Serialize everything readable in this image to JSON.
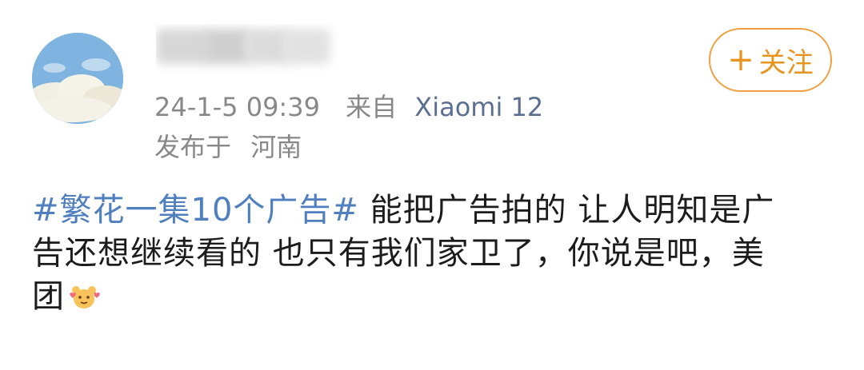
{
  "post": {
    "time": "24-1-5 09:39",
    "source_label": "来自",
    "device": "Xiaomi 12",
    "location_label": "发布于",
    "location": "河南",
    "follow_button": "关注",
    "follow_icon": "plus-icon",
    "hashtag": "#繁花一集10个广告#",
    "text_line1": "能把广告拍的 让人明知是广",
    "text_line2": "告还想继续看的 也只有我们家卫了，你说是吧，美",
    "text_line3": "团",
    "emoji": "heart-bear-emoji",
    "colors": {
      "accent": "#f0a040",
      "link": "#4f7fbf",
      "device": "#5b6f93",
      "meta": "#888888"
    }
  }
}
